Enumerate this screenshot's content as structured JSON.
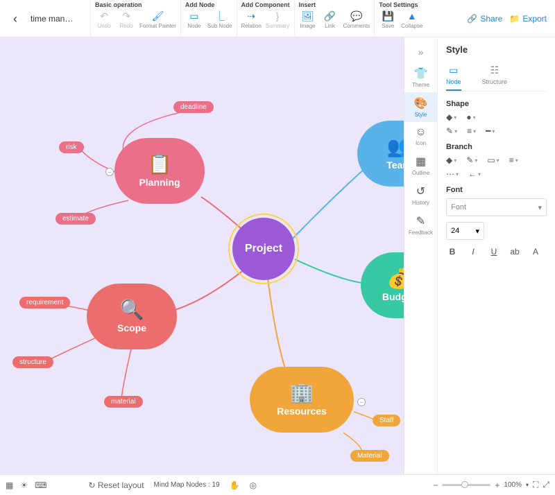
{
  "title": "time man…",
  "toolbar": {
    "groups": {
      "basic": {
        "title": "Basic operation",
        "undo": "Undo",
        "redo": "Redo",
        "format_painter": "Format Painter"
      },
      "add_node": {
        "title": "Add Node",
        "node": "Node",
        "sub_node": "Sub Node"
      },
      "add_component": {
        "title": "Add Component",
        "relation": "Relation",
        "summary": "Summary"
      },
      "insert": {
        "title": "Insert",
        "image": "Image",
        "link": "Link",
        "comments": "Comments"
      },
      "tool_settings": {
        "title": "Tool Settings",
        "save": "Save",
        "collapse": "Collapse"
      }
    },
    "share": "Share",
    "export": "Export"
  },
  "side_tabs": {
    "theme": "Theme",
    "style": "Style",
    "icon": "Icon",
    "outline": "Outline",
    "history": "History",
    "feedback": "Feedback"
  },
  "style_panel": {
    "title": "Style",
    "subtabs": {
      "node": "Node",
      "structure": "Structure"
    },
    "shape_title": "Shape",
    "branch_title": "Branch",
    "font_title": "Font",
    "font_placeholder": "Font",
    "font_size": "24",
    "fmt": {
      "bold": "B",
      "italic": "I",
      "underline": "U",
      "case": "ab",
      "color": "A"
    }
  },
  "mindmap": {
    "central": "Project",
    "planning": {
      "label": "Planning",
      "tags": [
        "deadline",
        "risk",
        "estimate"
      ]
    },
    "team": {
      "label": "Team"
    },
    "scope": {
      "label": "Scope",
      "tags": [
        "requirement",
        "structure",
        "material"
      ]
    },
    "budget": {
      "label": "Budget"
    },
    "resources": {
      "label": "Resources",
      "tags": [
        "Staff",
        "Material"
      ]
    }
  },
  "statusbar": {
    "reset_layout": "Reset layout",
    "nodes_label": "Mind Map Nodes :",
    "nodes_count": "19",
    "zoom": "100%"
  }
}
